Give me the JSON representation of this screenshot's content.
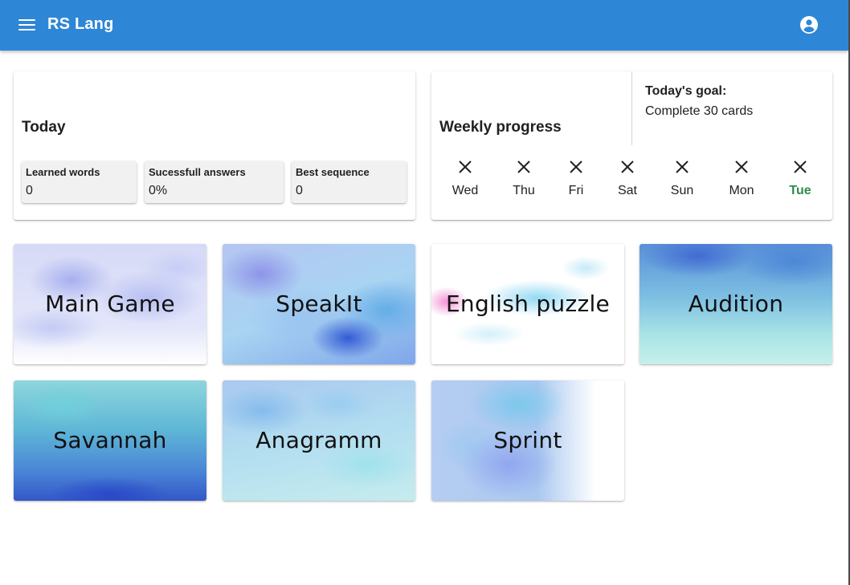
{
  "app": {
    "title": "RS Lang"
  },
  "icons": {
    "menu": "menu-icon",
    "account": "account-circle-icon",
    "missed_day": "close-icon"
  },
  "colors": {
    "appbar": "#2e86d6",
    "today_highlight": "#2e8b4e"
  },
  "today": {
    "heading": "Today",
    "stats": [
      {
        "label": "Learned words",
        "value": "0"
      },
      {
        "label": "Sucessfull answers",
        "value": "0%"
      },
      {
        "label": "Best sequence",
        "value": "0"
      }
    ]
  },
  "weekly": {
    "heading": "Weekly progress",
    "goal_title": "Today's goal:",
    "goal_text": "Complete 30 cards",
    "days": [
      {
        "label": "Wed",
        "today": false
      },
      {
        "label": "Thu",
        "today": false
      },
      {
        "label": "Fri",
        "today": false
      },
      {
        "label": "Sat",
        "today": false
      },
      {
        "label": "Sun",
        "today": false
      },
      {
        "label": "Mon",
        "today": false
      },
      {
        "label": "Tue",
        "today": true
      }
    ]
  },
  "games": [
    {
      "name": "Main Game"
    },
    {
      "name": "SpeakIt"
    },
    {
      "name": "English puzzle"
    },
    {
      "name": "Audition"
    },
    {
      "name": "Savannah"
    },
    {
      "name": "Anagramm"
    },
    {
      "name": "Sprint"
    }
  ]
}
